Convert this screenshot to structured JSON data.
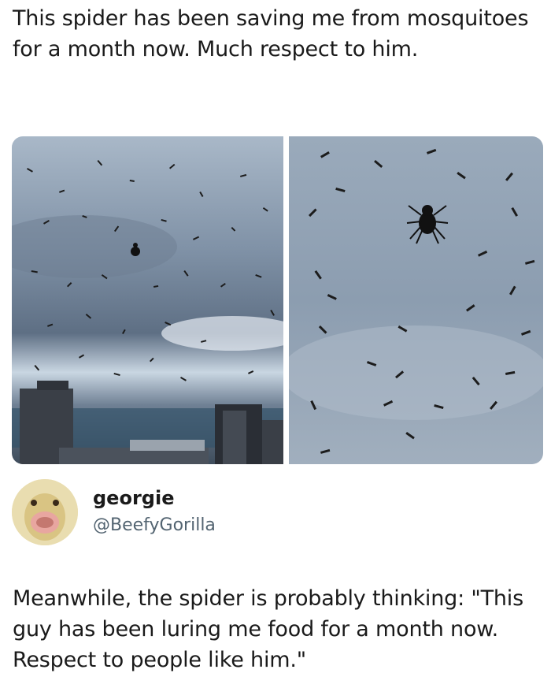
{
  "post": {
    "text": "This spider has been saving me from mosquitoes for a month now. Much respect to him.",
    "images": [
      {
        "icon": "spider-swarm-sky-wide"
      },
      {
        "icon": "spider-swarm-sky-closeup"
      }
    ]
  },
  "reply": {
    "avatar_icon": "goose-avatar",
    "display_name": "georgie",
    "handle": "@BeefyGorilla",
    "text": "Meanwhile, the spider is probably thinking: \"This guy has been luring me food for a month now. Respect to people like him.\""
  },
  "colors": {
    "text": "#1a1a1a",
    "handle": "#536471",
    "sky": "#8d9fb2"
  }
}
